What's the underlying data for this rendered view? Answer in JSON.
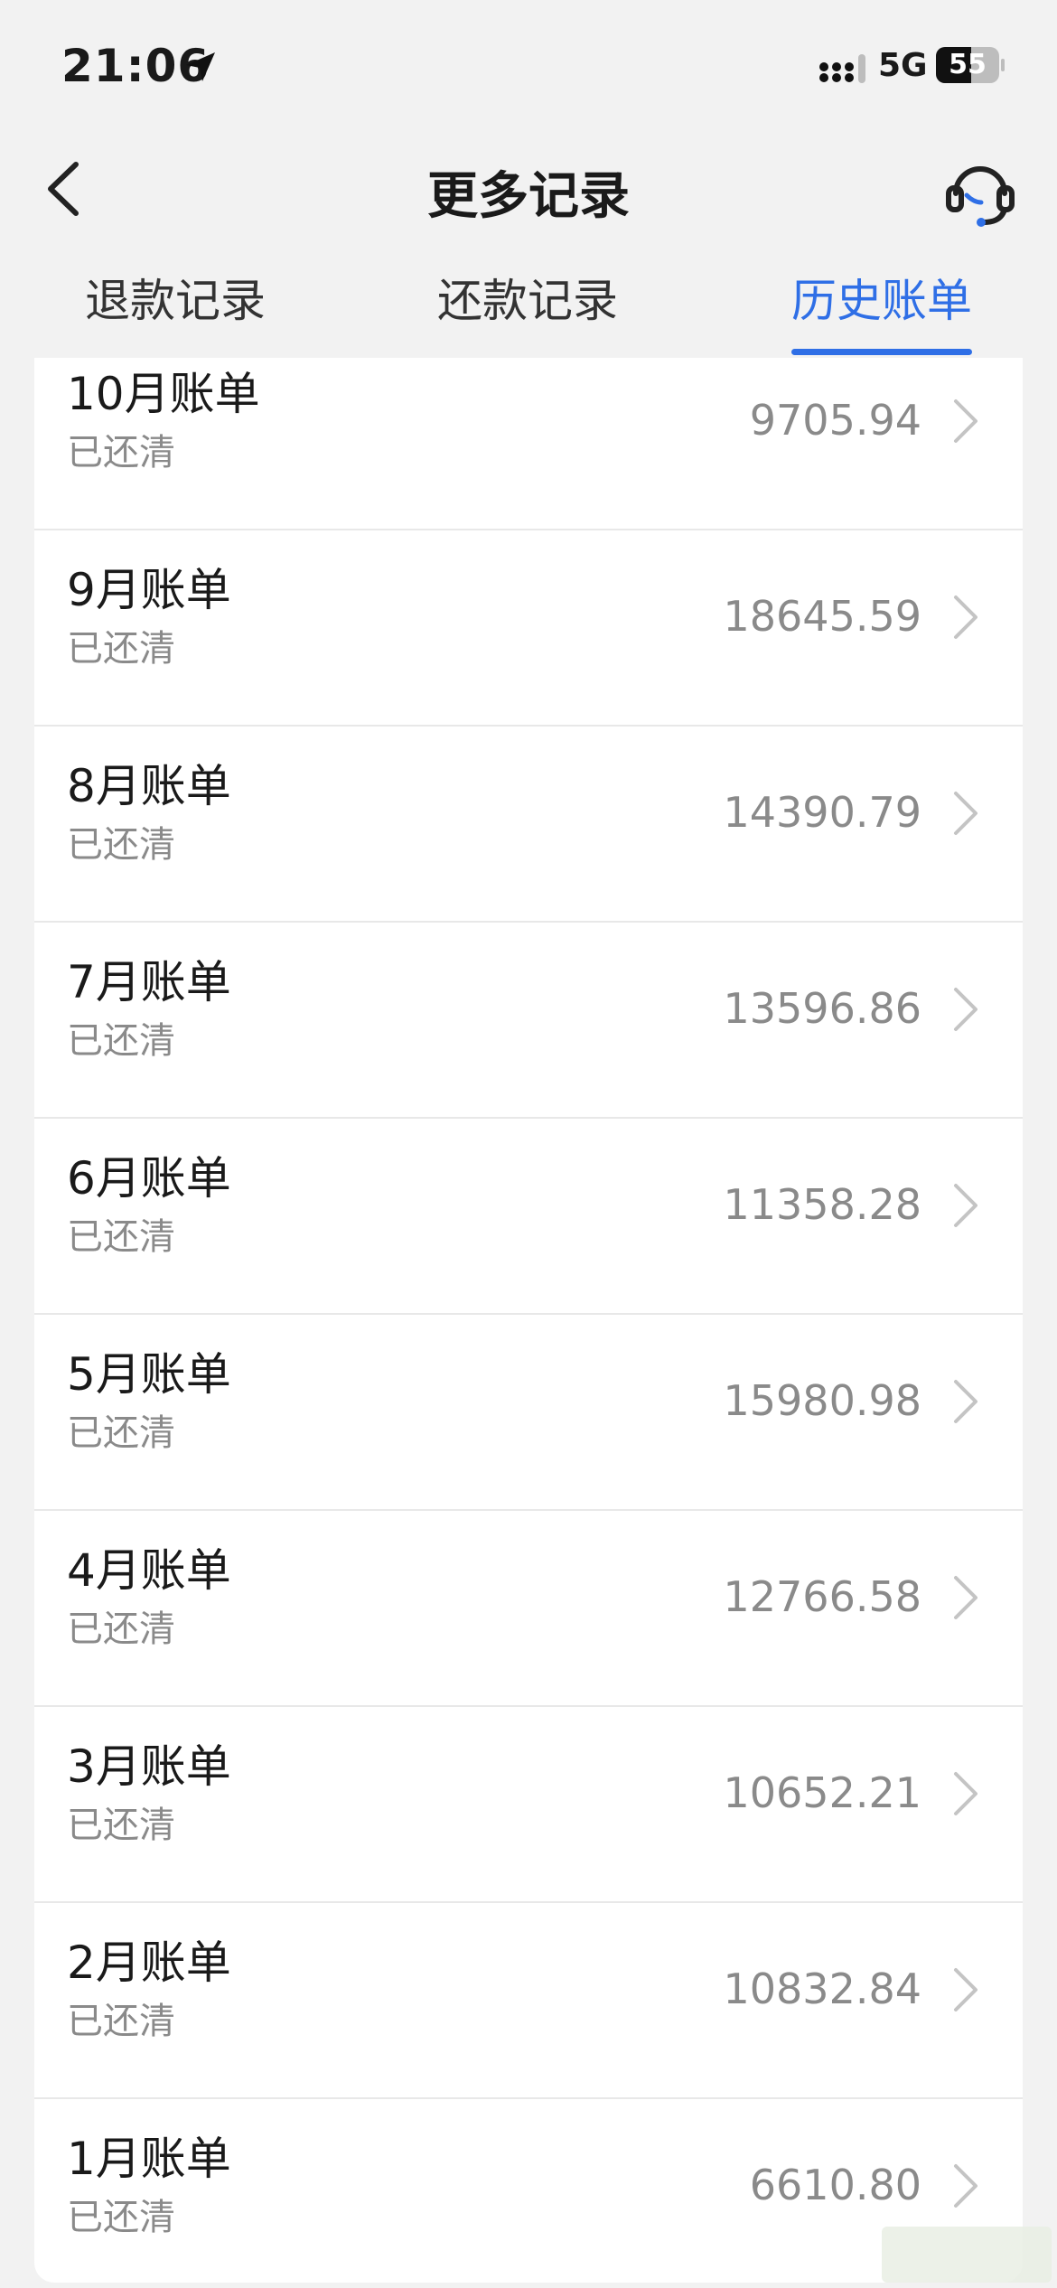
{
  "status_bar": {
    "time": "21:06",
    "network": "5G",
    "battery": "55",
    "battery_level_percent": 55,
    "location_icon": "location-arrow-icon",
    "signal_icon": "cellular-signal-icon"
  },
  "nav": {
    "title": "更多记录",
    "back_icon": "chevron-left-icon",
    "support_icon": "customer-service-headset-icon"
  },
  "tabs": [
    {
      "label": "退款记录",
      "active": false
    },
    {
      "label": "还款记录",
      "active": false
    },
    {
      "label": "历史账单",
      "active": true
    }
  ],
  "bills": [
    {
      "title": "10月账单",
      "status": "已还清",
      "amount": "9705.94"
    },
    {
      "title": "9月账单",
      "status": "已还清",
      "amount": "18645.59"
    },
    {
      "title": "8月账单",
      "status": "已还清",
      "amount": "14390.79"
    },
    {
      "title": "7月账单",
      "status": "已还清",
      "amount": "13596.86"
    },
    {
      "title": "6月账单",
      "status": "已还清",
      "amount": "11358.28"
    },
    {
      "title": "5月账单",
      "status": "已还清",
      "amount": "15980.98"
    },
    {
      "title": "4月账单",
      "status": "已还清",
      "amount": "12766.58"
    },
    {
      "title": "3月账单",
      "status": "已还清",
      "amount": "10652.21"
    },
    {
      "title": "2月账单",
      "status": "已还清",
      "amount": "10832.84"
    },
    {
      "title": "1月账单",
      "status": "已还清",
      "amount": "6610.80"
    }
  ],
  "colors": {
    "accent": "#2f6fe6",
    "background": "#f2f2f2",
    "secondary_text": "#8a8a8a"
  }
}
